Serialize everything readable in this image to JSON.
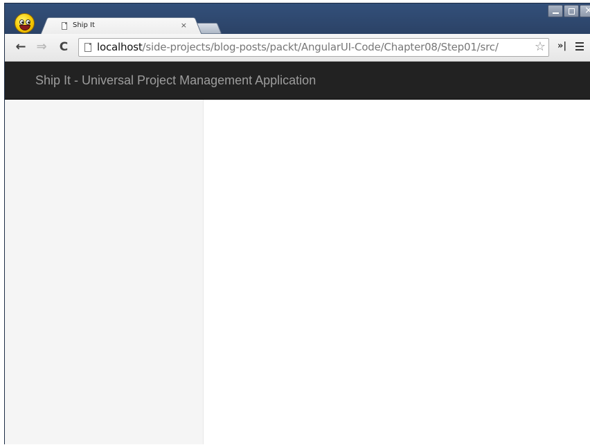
{
  "browser": {
    "tab": {
      "title": "Ship It",
      "close_glyph": "×"
    },
    "toolbar": {
      "back_glyph": "←",
      "forward_glyph": "⇒",
      "reload_glyph": "C",
      "url_host": "localhost",
      "url_path": "/side-projects/blog-posts/packt/AngularUI-Code/Chapter08/Step01/src/",
      "star_glyph": "☆",
      "overflow_glyph": "»|"
    },
    "icons": {
      "app": "smiley-logo-icon",
      "tab_page": "page-icon",
      "address_page": "page-icon",
      "bookmark": "star-icon",
      "menu": "hamburger-menu-icon"
    }
  },
  "app": {
    "brand": "Ship It - Universal Project Management Application"
  },
  "colors": {
    "window_frame": "#2d4569",
    "navbar_bg": "#222222",
    "brand_text": "#9d9d9d",
    "sidebar_bg": "#f5f5f5",
    "main_bg": "#ffffff"
  }
}
